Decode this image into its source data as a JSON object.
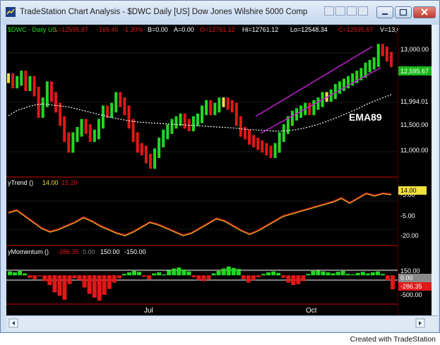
{
  "window": {
    "title": "TradeStation Chart Analysis - $DWC Daily [US] Dow Jones Wilshire 5000 Comp"
  },
  "header": {
    "symbol": "$DWC - Daily  US",
    "last": "L=12595.87",
    "change": "-165.45",
    "pct": "-1.30%",
    "bid": "B=0.00",
    "ask": "A=0.00",
    "open": "O=12761.12",
    "high": "Hi=12761.12",
    "low": "Lo=12548.34",
    "close": "C=12595.67",
    "volume": "V=13,6"
  },
  "price_scale": {
    "ticks": [
      "13,000.00",
      "12,000.00",
      "11,500.00",
      "11,000.00"
    ],
    "last_label": "12,595.67",
    "ema_label": "11,994.01"
  },
  "annotation": {
    "ema": "EMA89"
  },
  "ytrend": {
    "name": "yTrend ()",
    "v1": "14.00",
    "v2": "15.20",
    "ticks": [
      "-5.00",
      "-20.00"
    ],
    "last_label": "14.00"
  },
  "ymomentum": {
    "name": "yMomentum ()",
    "v1": "-286.35",
    "v2": "0.00",
    "v3": "150.00",
    "v4": "-150.00",
    "ticks": [
      "150.00",
      "0.00",
      "-500.00"
    ],
    "last_label": "-286.35",
    "zero_label": "0.00"
  },
  "x_axis": {
    "labels": [
      "Jul",
      "Oct"
    ]
  },
  "footer": {
    "watermark": "Created with TradeStation"
  },
  "colors": {
    "up": "#22d822",
    "down": "#e01818",
    "neutral": "#f0e040",
    "trend_a": "#f0c020",
    "trend_b": "#e02020",
    "channel": "#c020d0",
    "ema": "#ffffff"
  },
  "chart_data": [
    {
      "type": "line",
      "title": "$DWC - Daily  US",
      "xlabel": "",
      "ylabel": "",
      "ylim": [
        10600,
        13100
      ],
      "x_ticks": [
        "Jul",
        "Oct"
      ],
      "y_ticks": [
        11000,
        11500,
        12000,
        13000
      ],
      "series": [
        {
          "name": "",
          "values": [
            12300,
            12200,
            12250,
            12350,
            12150,
            12250,
            12050,
            11650,
            11850,
            12150,
            11950,
            11750,
            11500,
            11200,
            11000,
            11200,
            11300,
            11450,
            11350,
            11200,
            11250,
            11450,
            11700,
            11650,
            11750,
            11950,
            11850,
            11700,
            11450,
            11200,
            11000,
            10950,
            10800,
            10700,
            10900,
            11100,
            11250,
            11350,
            11450,
            11500,
            11550,
            11450,
            11400,
            11500,
            11550,
            11700,
            11800,
            11700,
            11750,
            11850,
            11850,
            11800,
            11750,
            11500,
            11300,
            11250,
            11150,
            11100,
            11050,
            11000,
            10950,
            10900,
            11000,
            11200,
            11350,
            11500,
            11600,
            11650,
            11700,
            11750,
            11700,
            11800,
            11850,
            11950,
            11950,
            12000,
            12100,
            12150,
            12200,
            12250,
            12300,
            12350,
            12400,
            12500,
            12550,
            12600,
            12850,
            12800,
            12700,
            12595.67
          ]
        },
        {
          "name": "EMA89",
          "values": [
            11600,
            11700,
            11750,
            11800,
            11820,
            11800,
            11780,
            11760,
            11720,
            11680,
            11640,
            11600,
            11560,
            11530,
            11500,
            11480,
            11470,
            11460,
            11450,
            11440,
            11430,
            11420,
            11410,
            11400,
            11390,
            11380,
            11370,
            11350,
            11340,
            11330,
            11320,
            11310,
            11320,
            11340,
            11370,
            11410,
            11460,
            11520,
            11580,
            11650,
            11720,
            11800,
            11870,
            11930,
            11994
          ]
        }
      ]
    },
    {
      "type": "line",
      "title": "yTrend ()",
      "ylim": [
        -25,
        22
      ],
      "y_ticks": [
        -20,
        -5
      ],
      "series": [
        {
          "name": "",
          "values": [
            -2,
            0,
            -5,
            -10,
            -15,
            -18,
            -16,
            -13,
            -10,
            -6,
            -9,
            -13,
            -16,
            -19,
            -21,
            -18,
            -14,
            -10,
            -12,
            -15,
            -18,
            -21,
            -19,
            -15,
            -11,
            -7,
            -9,
            -13,
            -17,
            -20,
            -17,
            -13,
            -9,
            -5,
            -3,
            -1,
            1,
            3,
            5,
            7,
            10,
            6,
            10,
            14,
            12,
            14,
            13.2
          ]
        },
        {
          "name": "",
          "values": [
            -1.2,
            0.8,
            -4.2,
            -9.2,
            -14.2,
            -17.2,
            -15.2,
            -12.2,
            -9.2,
            -5.2,
            -8.2,
            -12.2,
            -15.2,
            -18.2,
            -20.2,
            -17.2,
            -13.2,
            -9.2,
            -11.2,
            -14.2,
            -17.2,
            -20.2,
            -18.2,
            -14.2,
            -10.2,
            -6.2,
            -8.2,
            -12.2,
            -16.2,
            -19.2,
            -16.2,
            -12.2,
            -8.2,
            -4.2,
            -2.2,
            -0.2,
            1.8,
            3.8,
            5.8,
            7.8,
            10.8,
            6.8,
            10.8,
            14.8,
            12.8,
            14.8,
            14
          ]
        }
      ]
    },
    {
      "type": "bar",
      "title": "yMomentum ()",
      "ylim": [
        -560,
        220
      ],
      "y_ticks": [
        -500,
        0,
        150
      ],
      "series": [
        {
          "name": "",
          "values": [
            80,
            60,
            90,
            40,
            -50,
            -80,
            -20,
            -120,
            -200,
            -350,
            -420,
            -500,
            -180,
            -60,
            -100,
            -250,
            -380,
            -460,
            -520,
            -400,
            -280,
            -150,
            -60,
            30,
            60,
            90,
            70,
            -30,
            -80,
            40,
            60,
            20,
            100,
            140,
            160,
            120,
            80,
            -40,
            -100,
            -120,
            -80,
            40,
            90,
            140,
            180,
            150,
            130,
            -80,
            -150,
            -100,
            -40,
            30,
            60,
            80,
            50,
            -50,
            -150,
            -200,
            -180,
            -120,
            30,
            90,
            100,
            80,
            60,
            40,
            70,
            90,
            30,
            20,
            50,
            70,
            40,
            60,
            80,
            30,
            -100,
            -286.35
          ]
        }
      ]
    }
  ]
}
